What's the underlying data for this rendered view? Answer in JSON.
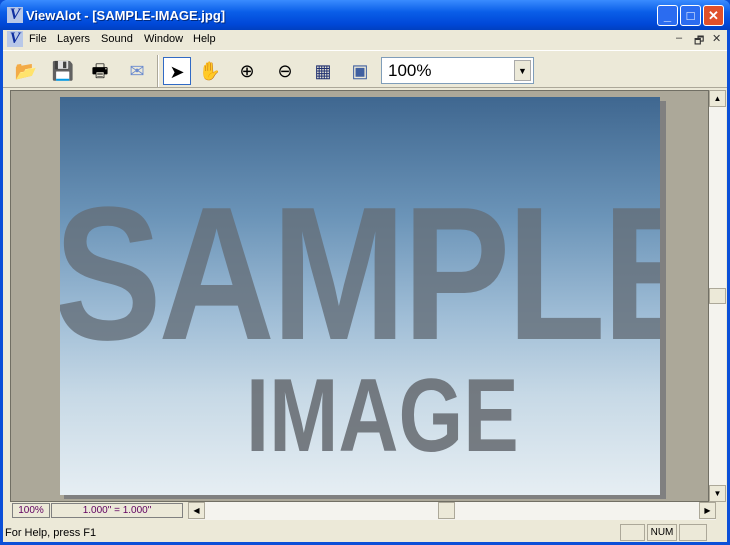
{
  "window": {
    "title": "ViewAlot - [SAMPLE-IMAGE.jpg]",
    "app_icon_glyph": "V"
  },
  "menu": {
    "items": [
      "File",
      "Layers",
      "Sound",
      "Window",
      "Help"
    ]
  },
  "toolbar": {
    "buttons": [
      "open-icon",
      "save-icon",
      "print-icon",
      "email-icon",
      "pointer-icon",
      "hand-icon",
      "zoom-in-icon",
      "zoom-out-icon",
      "fit-image-icon",
      "actual-size-icon"
    ],
    "selected": "pointer-icon",
    "zoom_value": "100%"
  },
  "image": {
    "line1": "SAMPLE",
    "line2": "IMAGE"
  },
  "bottom": {
    "zoom": "100%",
    "scale": "1.000\" = 1.000\""
  },
  "status": {
    "text": "For Help, press F1",
    "num": "NUM"
  }
}
